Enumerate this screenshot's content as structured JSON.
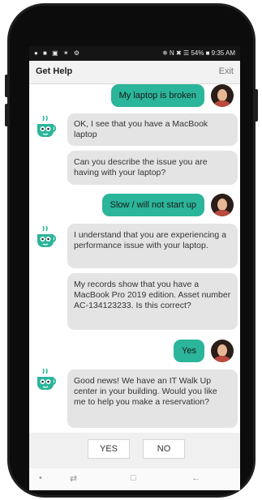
{
  "status": {
    "left_icons": "● ■ ▣ ✶ ⚙",
    "right": "✵ N ✖ ☰ 54% ■ 9:35 AM"
  },
  "header": {
    "title": "Get Help",
    "exit_label": "Exit"
  },
  "messages": [
    {
      "from": "user",
      "text": "My laptop is broken"
    },
    {
      "from": "bot",
      "text": "OK, I see that you have a MacBook laptop"
    },
    {
      "from": "bot",
      "text": "Can you describe the issue you are having with your laptop?"
    },
    {
      "from": "user",
      "text": "Slow / will not start up"
    },
    {
      "from": "bot",
      "text": "I understand that you are experiencing a performance issue with your laptop."
    },
    {
      "from": "bot",
      "text": "My records show that you have a MacBook Pro 2019 edition. Asset number AC-134123233. Is this correct?"
    },
    {
      "from": "user",
      "text": "Yes"
    },
    {
      "from": "bot",
      "text": "Good news! We have an IT Walk Up center in your building. Would you like me to help you make a reservation?"
    }
  ],
  "quick_replies": {
    "yes": "YES",
    "no": "NO"
  },
  "navbar": {
    "dot": "•",
    "recent": "⇄",
    "home": "□",
    "back": "←"
  },
  "colors": {
    "user_bubble": "#2bb59a",
    "bot_bubble": "#e4e4e4",
    "bot_icon": "#2bb59a"
  }
}
